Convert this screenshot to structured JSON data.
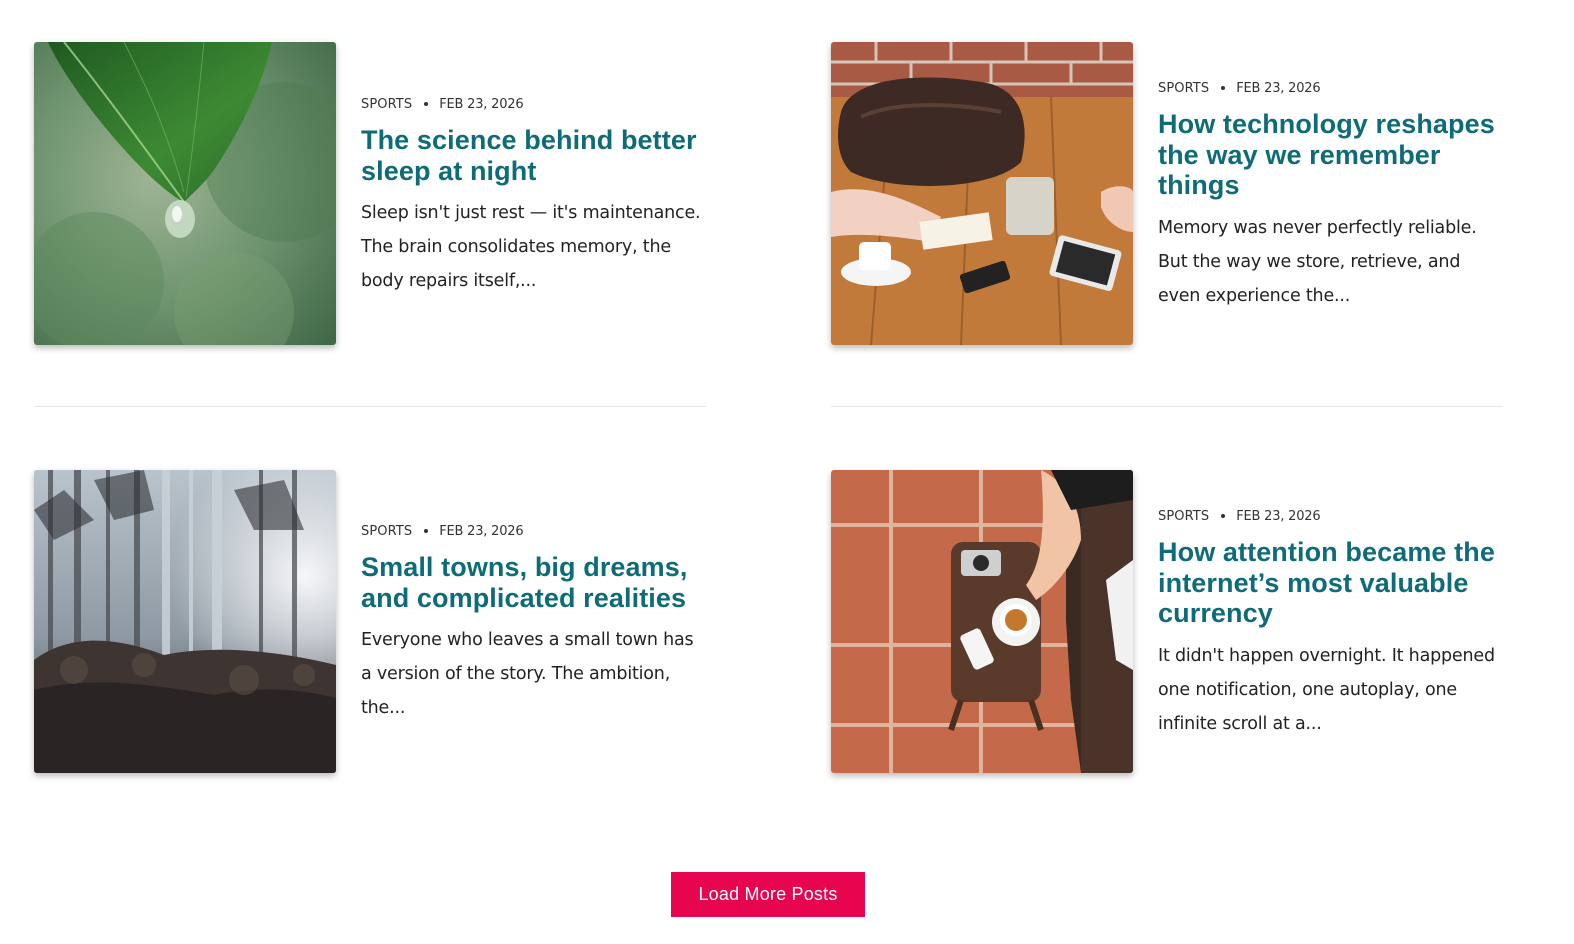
{
  "posts": [
    {
      "category": "SPORTS",
      "date": "FEB 23, 2026",
      "title": "The science behind better sleep at night",
      "excerpt": "Sleep isn't just rest — it's maintenance. The brain consolidates memory, the body repairs itself,..."
    },
    {
      "category": "SPORTS",
      "date": "FEB 23, 2026",
      "title": "How technology reshapes the way we remember things",
      "excerpt": "Memory was never perfectly reliable. But the way we store, retrieve, and even experience the..."
    },
    {
      "category": "SPORTS",
      "date": "FEB 23, 2026",
      "title": "Small towns, big dreams, and complicated realities",
      "excerpt": "Everyone who leaves a small town has a version of the story. The ambition, the..."
    },
    {
      "category": "SPORTS",
      "date": "FEB 23, 2026",
      "title": "How attention became the internet’s most valuable currency",
      "excerpt": "It didn't happen overnight. It happened one notification, one autoplay, one infinite scroll at a..."
    }
  ],
  "load_more_label": "Load More Posts",
  "colors": {
    "title": "#0e6b78",
    "button": "#e8054f",
    "text": "#222222"
  }
}
